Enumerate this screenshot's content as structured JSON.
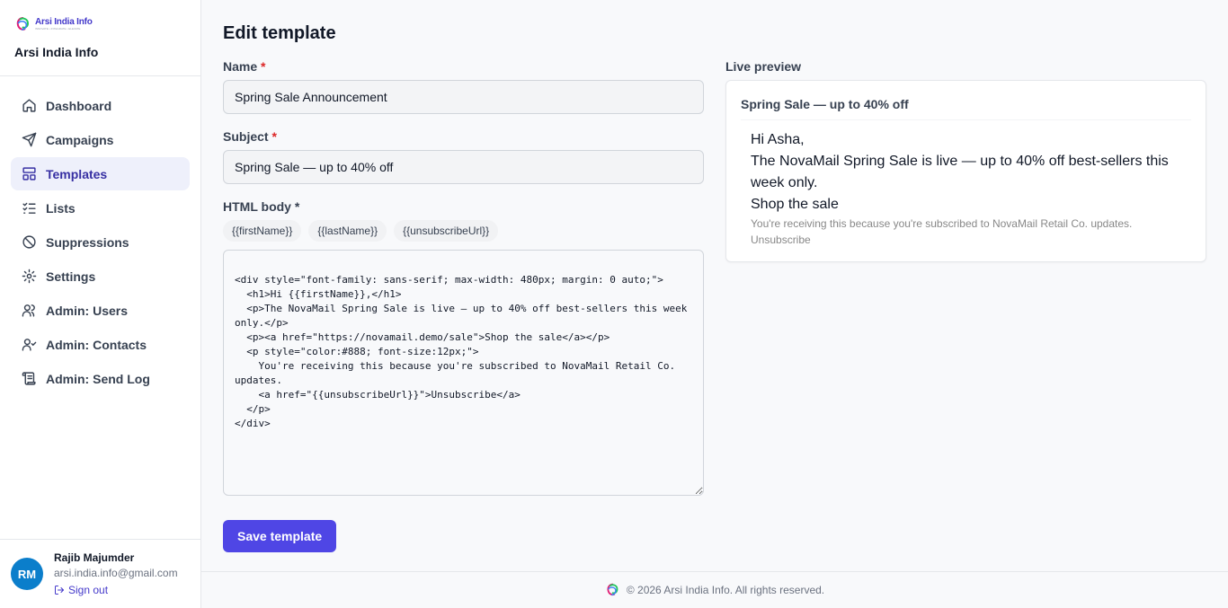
{
  "brand": {
    "logo_text": "Arsi India Info",
    "logo_tagline": "INNOVATE • INTEGRATE • ELEVATE",
    "name": "Arsi India Info"
  },
  "nav": {
    "items": [
      {
        "label": "Dashboard",
        "icon": "home-icon"
      },
      {
        "label": "Campaigns",
        "icon": "send-icon"
      },
      {
        "label": "Templates",
        "icon": "layout-icon",
        "active": true
      },
      {
        "label": "Lists",
        "icon": "list-checks-icon"
      },
      {
        "label": "Suppressions",
        "icon": "ban-icon"
      },
      {
        "label": "Settings",
        "icon": "gear-icon"
      },
      {
        "label": "Admin: Users",
        "icon": "users-icon"
      },
      {
        "label": "Admin: Contacts",
        "icon": "user-check-icon"
      },
      {
        "label": "Admin: Send Log",
        "icon": "scroll-icon"
      }
    ]
  },
  "user": {
    "initials": "RM",
    "name": "Rajib Majumder",
    "email": "arsi.india.info@gmail.com",
    "signout_label": "Sign out"
  },
  "page": {
    "title": "Edit template"
  },
  "form": {
    "name_label": "Name",
    "name_value": "Spring Sale Announcement",
    "subject_label": "Subject",
    "subject_value": "Spring Sale — up to 40% off",
    "body_label": "HTML body *",
    "chips": [
      "{{firstName}}",
      "{{lastName}}",
      "{{unsubscribeUrl}}"
    ],
    "body_value": "<div style=\"font-family: sans-serif; max-width: 480px; margin: 0 auto;\">\n  <h1>Hi {{firstName}},</h1>\n  <p>The NovaMail Spring Sale is live — up to 40% off best-sellers this week only.</p>\n  <p><a href=\"https://novamail.demo/sale\">Shop the sale</a></p>\n  <p style=\"color:#888; font-size:12px;\">\n    You're receiving this because you're subscribed to NovaMail Retail Co. updates.\n    <a href=\"{{unsubscribeUrl}}\">Unsubscribe</a>\n  </p>\n</div>",
    "save_label": "Save template"
  },
  "preview": {
    "label": "Live preview",
    "subject": "Spring Sale — up to 40% off",
    "greeting": "Hi Asha,",
    "paragraph": "The NovaMail Spring Sale is live — up to 40% off best-sellers this week only.",
    "link_text": "Shop the sale",
    "fine_print": "You're receiving this because you're subscribed to NovaMail Retail Co. updates.",
    "unsubscribe_text": "Unsubscribe"
  },
  "footer": {
    "text": "© 2026 Arsi India Info. All rights reserved."
  },
  "colors": {
    "accent": "#4f46e5",
    "active_nav_bg": "#eef0fb",
    "avatar": "#0b7ecb",
    "required": "#dc2626"
  }
}
